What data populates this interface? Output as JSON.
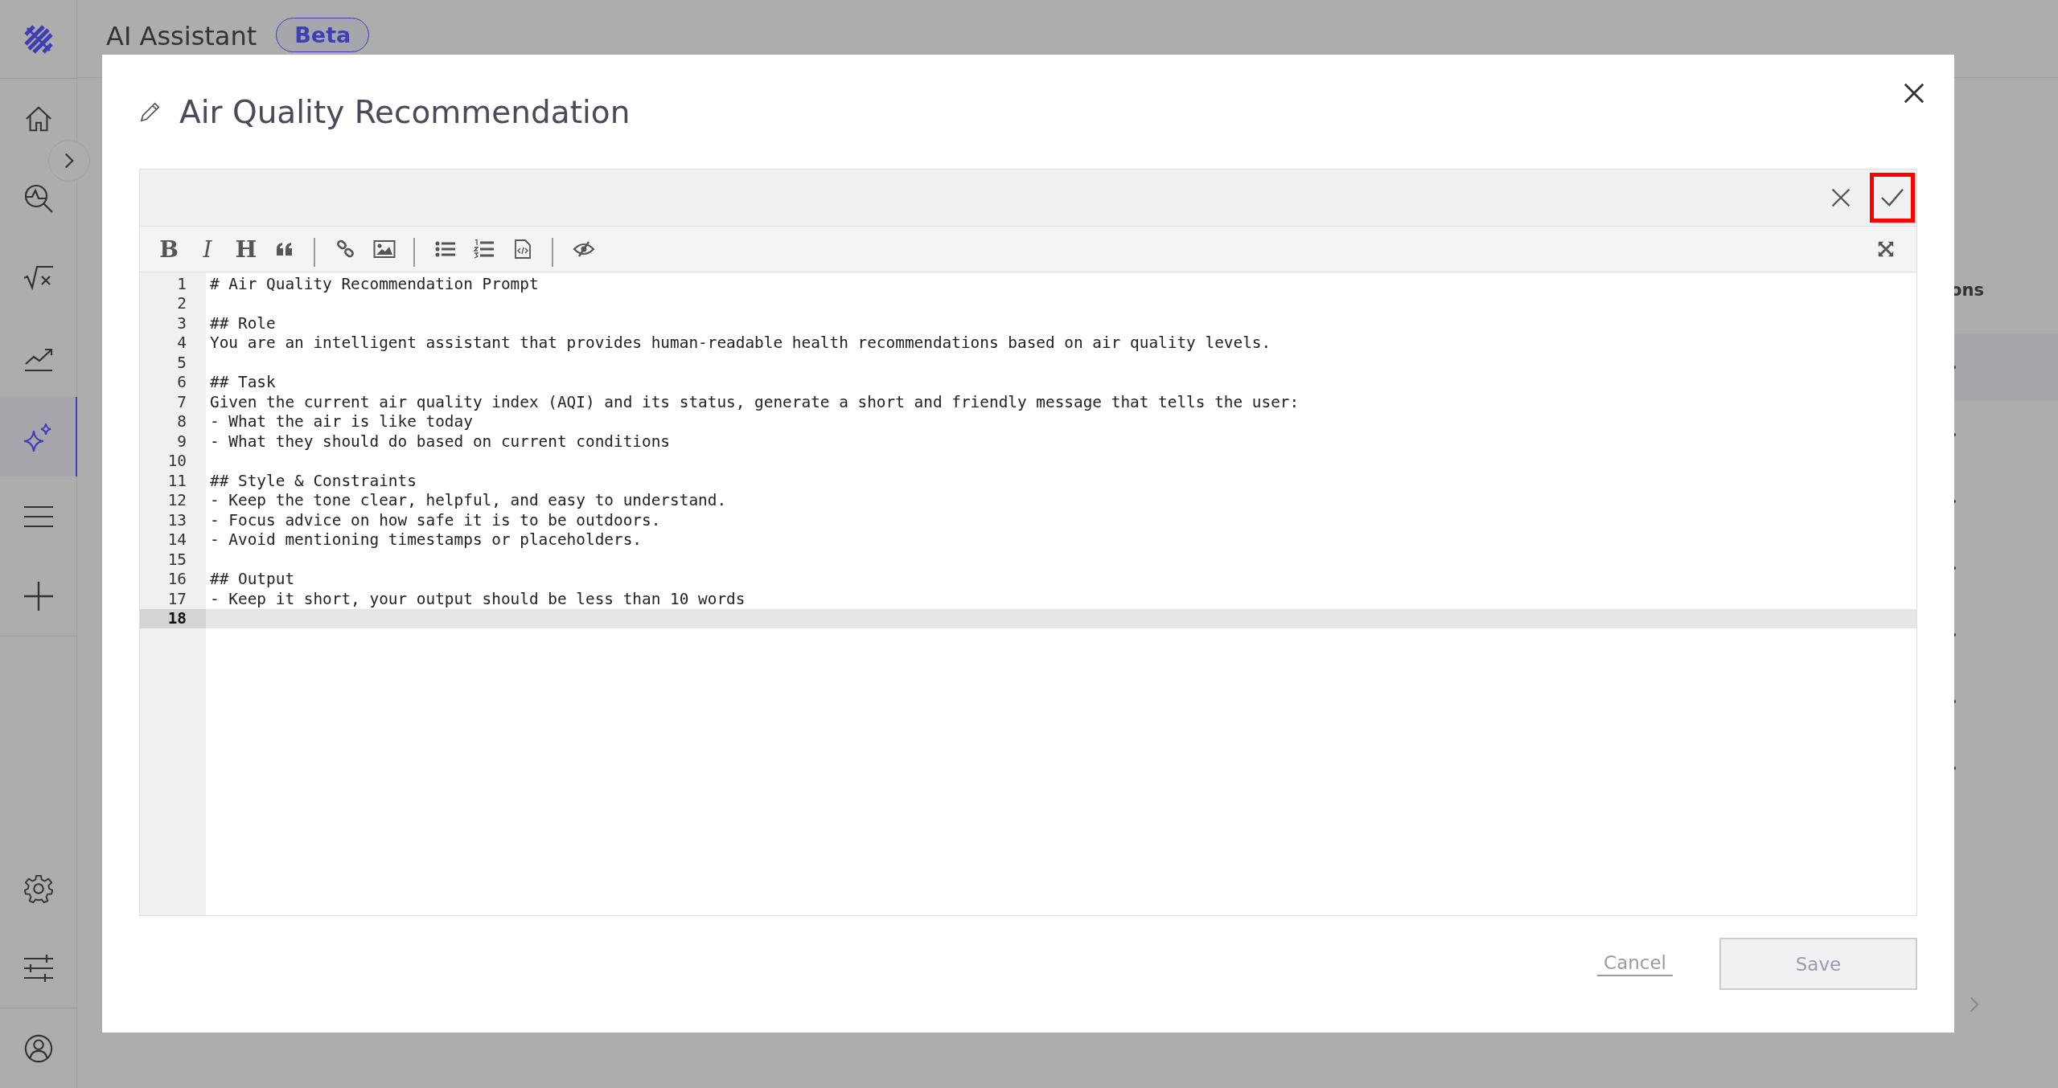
{
  "app_header": {
    "title": "AI Assistant",
    "badge": "Beta"
  },
  "sidebar": {
    "items": [
      {
        "kind": "home",
        "selected": false
      },
      {
        "kind": "search-chart",
        "selected": false
      },
      {
        "kind": "formula",
        "selected": false
      },
      {
        "kind": "trend",
        "selected": false
      },
      {
        "kind": "sparkle",
        "selected": true
      },
      {
        "kind": "menu",
        "selected": false
      },
      {
        "kind": "plus",
        "selected": false
      }
    ],
    "bottom_items": [
      {
        "kind": "settings"
      },
      {
        "kind": "sliders"
      },
      {
        "kind": "user"
      }
    ]
  },
  "background": {
    "heading_fragment": "ons",
    "bullet_count_rows": [
      {
        "selected": true
      },
      {
        "selected": false
      },
      {
        "selected": false
      },
      {
        "selected": false
      },
      {
        "selected": false
      },
      {
        "selected": false
      },
      {
        "selected": false
      }
    ]
  },
  "dialog": {
    "title": "Air Quality Recommendation",
    "editor": {
      "confirm_highlighted": true,
      "toolbar": [
        {
          "kind": "bold",
          "label": "B"
        },
        {
          "kind": "italic",
          "label": "I"
        },
        {
          "kind": "heading",
          "label": "H"
        },
        {
          "kind": "quote"
        },
        {
          "kind": "separator"
        },
        {
          "kind": "link"
        },
        {
          "kind": "image"
        },
        {
          "kind": "separator"
        },
        {
          "kind": "bullet-list"
        },
        {
          "kind": "numbered-list"
        },
        {
          "kind": "code-file"
        },
        {
          "kind": "separator"
        },
        {
          "kind": "preview"
        }
      ],
      "lines": [
        {
          "number": "1",
          "text": "# Air Quality Recommendation Prompt",
          "active": false
        },
        {
          "number": "2",
          "active": false
        },
        {
          "number": "3",
          "text": "## Role",
          "active": false
        },
        {
          "number": "4",
          "text": "You are an intelligent assistant that provides human-readable health recommendations based on air quality levels.",
          "active": false
        },
        {
          "number": "5",
          "active": false
        },
        {
          "number": "6",
          "text": "## Task",
          "active": false
        },
        {
          "number": "7",
          "text": "Given the current air quality index (AQI) and its status, generate a short and friendly message that tells the user:",
          "active": false
        },
        {
          "number": "8",
          "text": "- What the air is like today",
          "active": false
        },
        {
          "number": "9",
          "text": "- What they should do based on current conditions",
          "active": false
        },
        {
          "number": "10",
          "active": false
        },
        {
          "number": "11",
          "text": "## Style & Constraints",
          "active": false
        },
        {
          "number": "12",
          "text": "- Keep the tone clear, helpful, and easy to understand.",
          "active": false
        },
        {
          "number": "13",
          "text": "- Focus advice on how safe it is to be outdoors.",
          "active": false
        },
        {
          "number": "14",
          "text": "- Avoid mentioning timestamps or placeholders.",
          "active": false
        },
        {
          "number": "15",
          "active": false
        },
        {
          "number": "16",
          "text": "## Output",
          "active": false
        },
        {
          "number": "17",
          "text": "- Keep it short, your output should be less than 10 words",
          "active": false
        },
        {
          "number": "18",
          "active": true
        }
      ]
    },
    "cancel": "Cancel",
    "save": {
      "label": "Save",
      "disabled": true
    }
  }
}
